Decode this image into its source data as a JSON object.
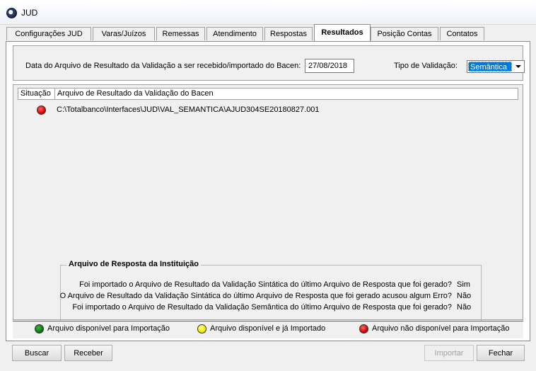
{
  "window": {
    "title": "JUD"
  },
  "tabs": [
    {
      "label": "Configurações JUD",
      "active": false
    },
    {
      "label": "Varas/Juízos",
      "active": false
    },
    {
      "label": "Remessas",
      "active": false
    },
    {
      "label": "Atendimento",
      "active": false
    },
    {
      "label": "Respostas",
      "active": false
    },
    {
      "label": "Resultados",
      "active": true
    },
    {
      "label": "Posição Contas",
      "active": false
    },
    {
      "label": "Contatos",
      "active": false
    }
  ],
  "filters": {
    "date_label": "Data do Arquivo de Resultado da Validação a ser recebido/importado do Bacen:",
    "date_value": "27/08/2018",
    "type_label": "Tipo de Validação:",
    "type_value": "Semântica"
  },
  "grid": {
    "columns": [
      "Situação",
      "Arquivo de Resultado da Validação do Bacen"
    ],
    "rows": [
      {
        "status": "red",
        "file": "C:\\Totalbanco\\Interfaces\\JUD\\VAL_SEMANTICA\\AJUD304SE20180827.001"
      }
    ]
  },
  "response_group": {
    "title": "Arquivo de Resposta da Instituição",
    "items": [
      {
        "question": "Foi importado o Arquivo de Resultado da Validação Sintática do último Arquivo de Resposta que foi gerado?",
        "answer": "Sim"
      },
      {
        "question": "O Arquivo de Resultado da Validação Sintática do último Arquivo de Resposta que foi gerado acusou algum Erro?",
        "answer": "Não"
      },
      {
        "question": "Foi importado o Arquivo de Resultado da Validação Semântica do último Arquivo de Resposta que foi gerado?",
        "answer": "Não"
      }
    ]
  },
  "legend": [
    {
      "color": "green",
      "label": "Arquivo disponível para Importação"
    },
    {
      "color": "yellow",
      "label": "Arquivo disponível e já Importado"
    },
    {
      "color": "red",
      "label": "Arquivo não disponível para Importação"
    }
  ],
  "buttons": {
    "buscar": "Buscar",
    "receber": "Receber",
    "importar": "Importar",
    "fechar": "Fechar"
  },
  "colors": {
    "selection": "#0078d7",
    "status_red": "#e00000",
    "status_green": "#0a7a0a",
    "status_yellow": "#f5f000"
  }
}
